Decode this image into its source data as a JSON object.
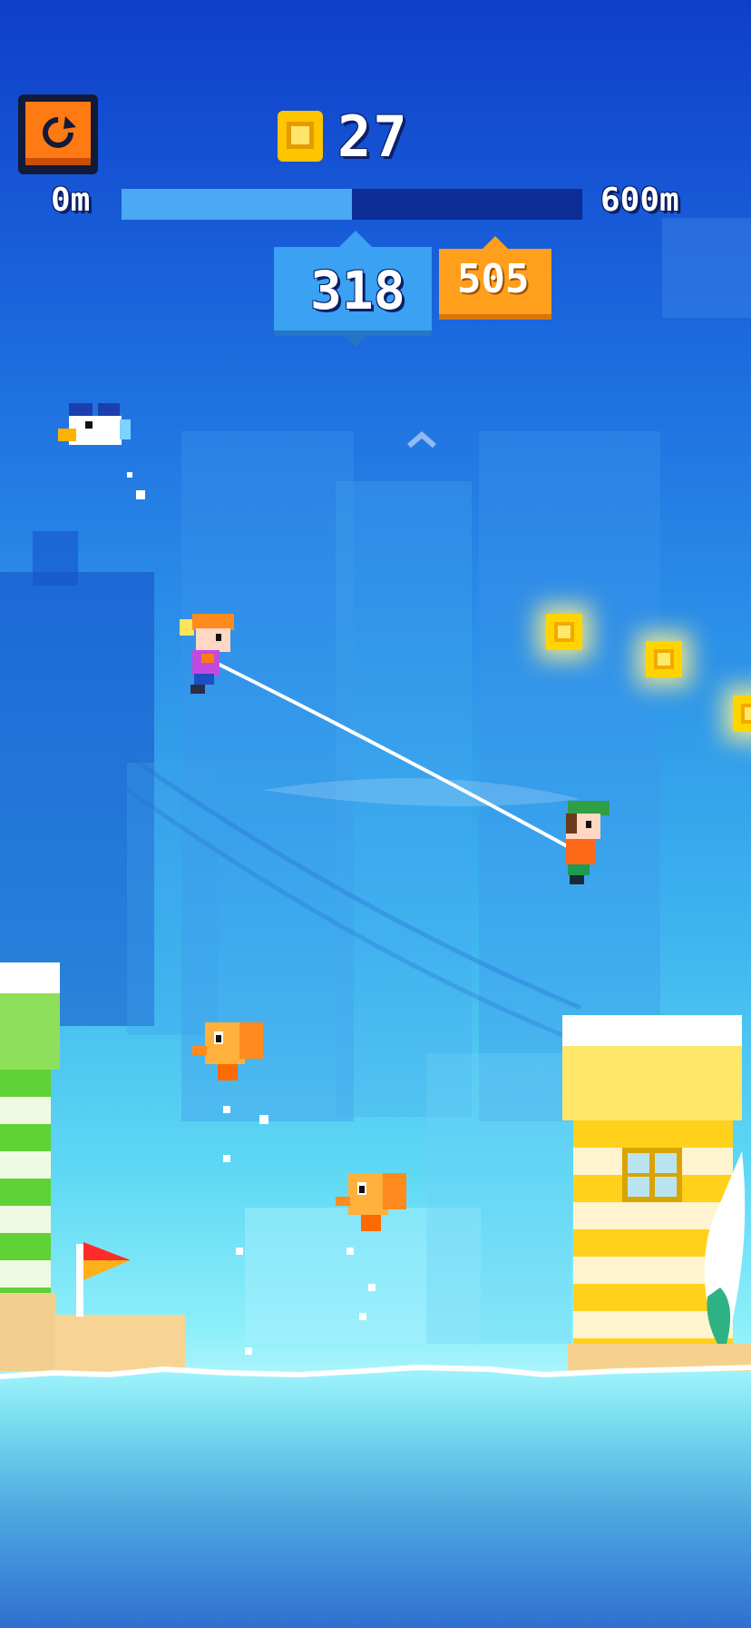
{
  "hud": {
    "coins": "27",
    "coin_icon": "coin-icon",
    "restart_icon": "restart-icon",
    "progress": {
      "start_label": "0m",
      "end_label": "600m",
      "fraction": 0.5
    },
    "current_score": "318",
    "best_score": "505"
  },
  "colors": {
    "sky_top": "#0f3fc9",
    "sea": "#8ff0fa",
    "restart_button": "#ff7a12",
    "score_box": "#3aa1f3",
    "best_box": "#ff9f1c",
    "coin": "#ffd400"
  },
  "scene": {
    "characters": [
      "player-girl",
      "player-boy"
    ],
    "rope_icon": "rope",
    "enemies": [
      "seagull",
      "orange-bird",
      "orange-bird"
    ],
    "landmarks": [
      "green-striped-lighthouse",
      "yellow-striped-lighthouse"
    ],
    "flag_icon": "red-flag-icon",
    "scroll_hint_icon": "chevron-up-icon"
  }
}
